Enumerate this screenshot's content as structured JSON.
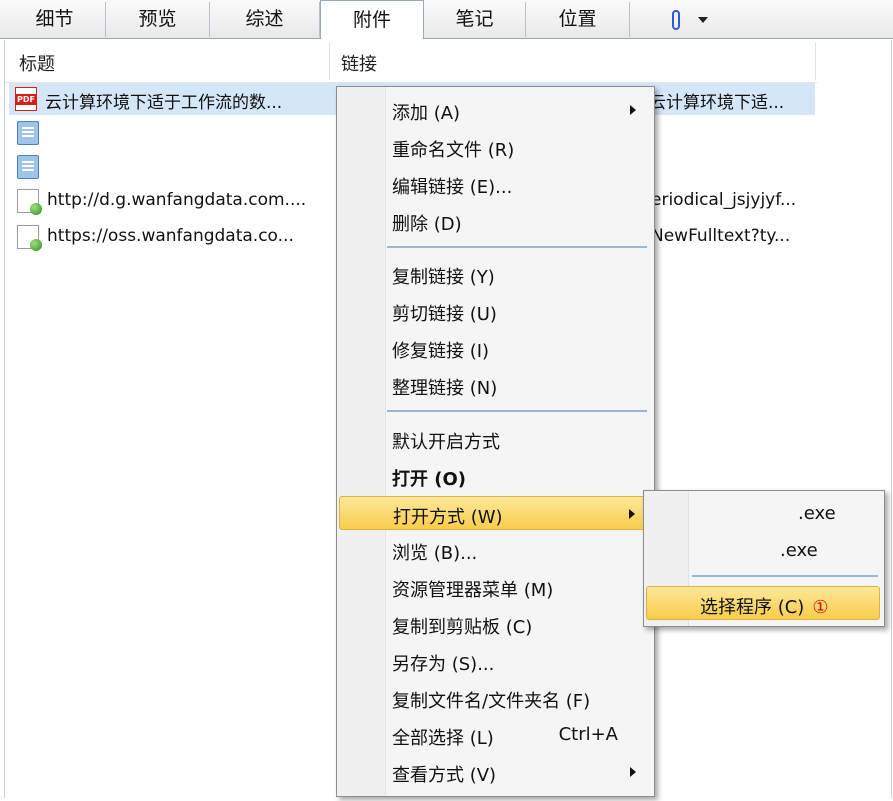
{
  "tabs": [
    {
      "label": "细节"
    },
    {
      "label": "预览"
    },
    {
      "label": "综述"
    },
    {
      "label": "附件"
    },
    {
      "label": "笔记"
    },
    {
      "label": "位置"
    }
  ],
  "columns": {
    "title": "标题",
    "link": "链接"
  },
  "rows": [
    {
      "icon": "pdf-icon",
      "icon_text": "PDF",
      "title": "云计算环境下适于工作流的数...",
      "link": "云计算环境下适..."
    },
    {
      "icon": "note-icon",
      "title": "",
      "link": ""
    },
    {
      "icon": "note-icon",
      "title": "",
      "link": ""
    },
    {
      "icon": "web-link-icon",
      "title": "http://d.g.wanfangdata.com....",
      "link": "eriodical_jsjyjyf..."
    },
    {
      "icon": "web-link-icon",
      "title": "https://oss.wanfangdata.co...",
      "link": "NewFulltext?ty..."
    }
  ],
  "context_menu": {
    "items": [
      {
        "label": "添加 (A)",
        "submenu": true
      },
      {
        "label": "重命名文件 (R)"
      },
      {
        "label": "编辑链接 (E)..."
      },
      {
        "label": "删除 (D)"
      },
      {
        "label": "复制链接 (Y)"
      },
      {
        "label": "剪切链接 (U)"
      },
      {
        "label": "修复链接 (I)"
      },
      {
        "label": "整理链接 (N)"
      },
      {
        "label": "默认开启方式"
      },
      {
        "label": "打开 (O)"
      },
      {
        "label": "打开方式 (W)",
        "submenu": true
      },
      {
        "label": "浏览 (B)..."
      },
      {
        "label": "资源管理器菜单 (M)"
      },
      {
        "label": "复制到剪贴板 (C)"
      },
      {
        "label": "另存为 (S)..."
      },
      {
        "label": "复制文件名/文件夹名 (F)"
      },
      {
        "label": "全部选择 (L)",
        "shortcut": "Ctrl+A"
      },
      {
        "label": "查看方式 (V)",
        "submenu": true
      }
    ]
  },
  "open_with_submenu": {
    "items": [
      {
        "label": ".exe"
      },
      {
        "label": ".exe"
      },
      {
        "label": "选择程序 (C)",
        "marker": "①"
      }
    ]
  },
  "colors": {
    "highlight": "#f9cc4c",
    "selection": "#d5e6f7",
    "marker": "#d01010"
  }
}
